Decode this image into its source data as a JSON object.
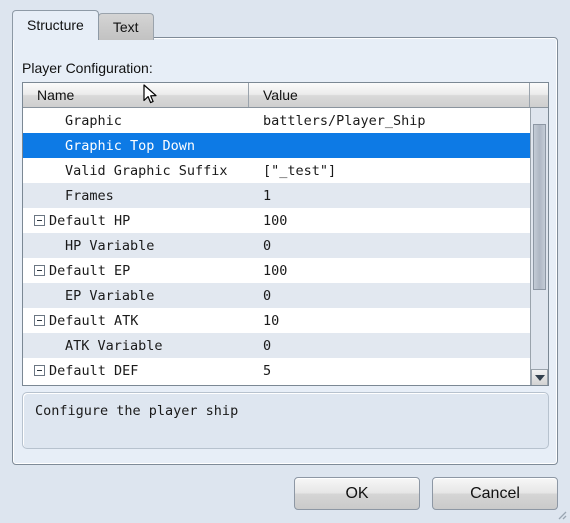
{
  "dialog": {
    "background_color": "#dde5ef",
    "panel_color": "#e7eef7"
  },
  "tabs": [
    {
      "label": "Structure",
      "active": true
    },
    {
      "label": "Text",
      "active": false
    }
  ],
  "section": {
    "label": "Player Configuration:"
  },
  "tree": {
    "columns": [
      "Name",
      "Value"
    ],
    "selection_color": "#0d7ae5",
    "rows": [
      {
        "name": "Graphic",
        "value": "battlers/Player_Ship",
        "indent": 1,
        "expander": "none",
        "selected": false
      },
      {
        "name": "Graphic Top Down",
        "value": "",
        "indent": 1,
        "expander": "none",
        "selected": true
      },
      {
        "name": "Valid Graphic Suffix",
        "value": "[\"_test\"]",
        "indent": 1,
        "expander": "none",
        "selected": false
      },
      {
        "name": "Frames",
        "value": "1",
        "indent": 1,
        "expander": "none",
        "selected": false
      },
      {
        "name": "Default HP",
        "value": "100",
        "indent": 0,
        "expander": "expanded",
        "selected": false
      },
      {
        "name": "HP Variable",
        "value": "0",
        "indent": 1,
        "expander": "none",
        "selected": false
      },
      {
        "name": "Default EP",
        "value": "100",
        "indent": 0,
        "expander": "expanded",
        "selected": false
      },
      {
        "name": "EP Variable",
        "value": "0",
        "indent": 1,
        "expander": "none",
        "selected": false
      },
      {
        "name": "Default ATK",
        "value": "10",
        "indent": 0,
        "expander": "expanded",
        "selected": false
      },
      {
        "name": "ATK Variable",
        "value": "0",
        "indent": 1,
        "expander": "none",
        "selected": false
      },
      {
        "name": "Default DEF",
        "value": "5",
        "indent": 0,
        "expander": "expanded",
        "selected": false
      }
    ]
  },
  "description": {
    "text": "Configure the player ship"
  },
  "buttons": {
    "ok": "OK",
    "cancel": "Cancel"
  },
  "icons": {
    "scroll_up": "triangle-up-icon",
    "scroll_down": "triangle-down-icon",
    "expander": "minus-box-icon",
    "cursor": "mouse-pointer-icon",
    "grip": "resize-grip-icon"
  }
}
